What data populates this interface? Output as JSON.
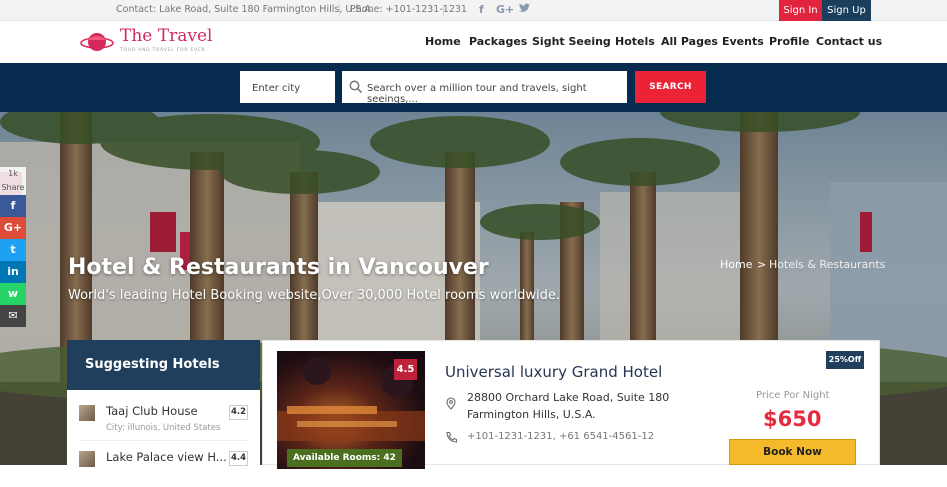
{
  "topbar": {
    "contact": "Contact: Lake Road, Suite 180 Farmington Hills, U.S.A.",
    "phone": "Phone: +101-1231-1231",
    "social_icons": [
      "facebook-icon",
      "google-plus-icon",
      "twitter-icon"
    ],
    "signin_label": "Sign In",
    "signup_label": "Sign Up"
  },
  "header": {
    "logo_title": "The Travel",
    "logo_tagline": "TOUR AND TRAVEL FOR EVER",
    "nav": [
      "Home",
      "Packages",
      "Sight Seeing",
      "Hotels",
      "All Pages",
      "Events",
      "Profile",
      "Contact us"
    ]
  },
  "search": {
    "city_placeholder": "Enter city",
    "query_placeholder": "Search over a million tour and travels, sight seeings,...",
    "button_label": "SEARCH"
  },
  "hero": {
    "title": "Hotel & Restaurants in Vancouver",
    "subtitle": "World's leading Hotel Booking website,Over 30,000 Hotel rooms worldwide.",
    "breadcrumb_home": "Home",
    "breadcrumb_sep": ">",
    "breadcrumb_current": "Hotels & Restaurants"
  },
  "share": {
    "count": "1k",
    "label": "Share",
    "buttons": [
      {
        "icon": "facebook-icon",
        "glyph": "f",
        "color": "#3b5998"
      },
      {
        "icon": "google-plus-icon",
        "glyph": "G+",
        "color": "#dd4b39"
      },
      {
        "icon": "twitter-icon",
        "glyph": "t",
        "color": "#1da1f2"
      },
      {
        "icon": "linkedin-icon",
        "glyph": "in",
        "color": "#0077b5"
      },
      {
        "icon": "whatsapp-icon",
        "glyph": "w",
        "color": "#25d366"
      },
      {
        "icon": "email-icon",
        "glyph": "✉",
        "color": "#444444"
      }
    ]
  },
  "sidebar": {
    "title": "Suggesting Hotels",
    "items": [
      {
        "name": "Taaj Club House",
        "city": "City: illunois, United States",
        "rating": "4.2"
      },
      {
        "name": "Lake Palace view H...",
        "city": "",
        "rating": "4.4"
      }
    ]
  },
  "listing": {
    "name": "Universal luxury Grand Hotel",
    "rating": "4.5",
    "available": "Available Rooms: 42",
    "address_line1": "28800 Orchard Lake Road, Suite 180",
    "address_line2": "Farmington Hills, U.S.A.",
    "phone": "+101-1231-1231, +61 6541-4561-12",
    "discount": "25%Off",
    "price_label": "Price Por Night",
    "price": "$650",
    "book_label": "Book Now"
  },
  "colors": {
    "brand_red": "#e2233e",
    "brand_navy": "#1b3e5c",
    "search_bg": "#072a4f",
    "price_red": "#e62a3f",
    "book_yellow": "#f5b92c"
  }
}
